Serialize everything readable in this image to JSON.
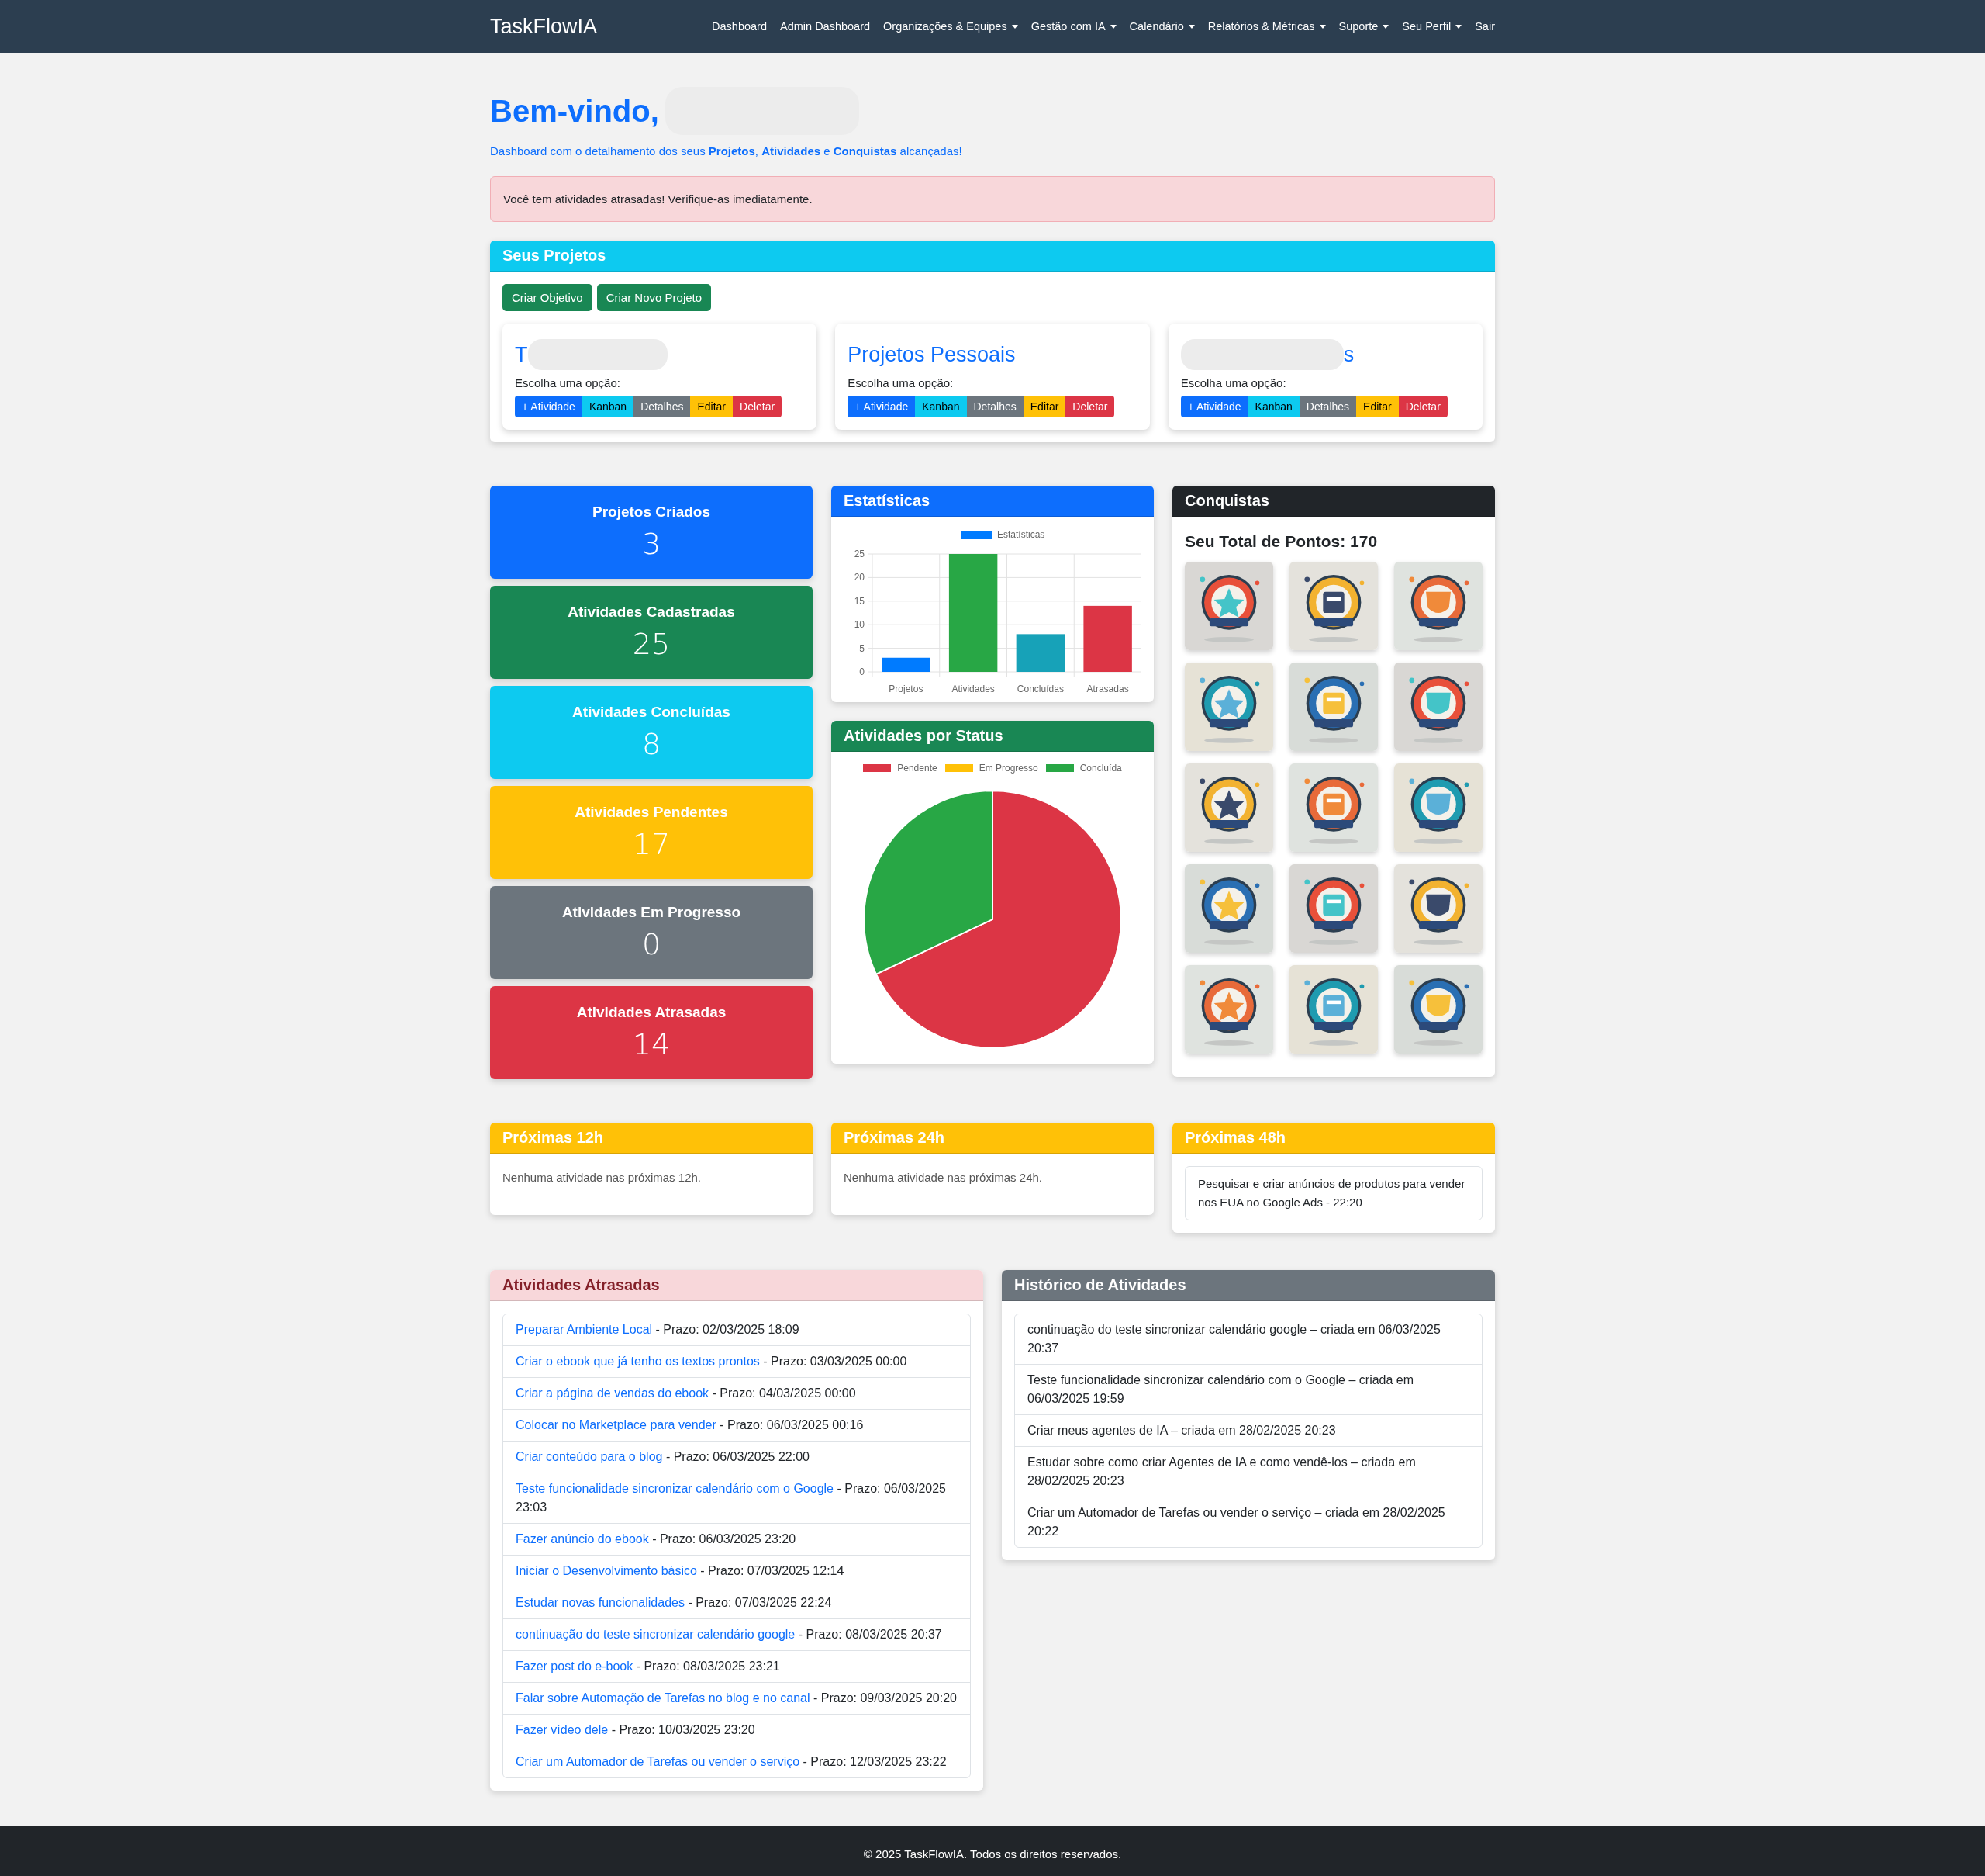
{
  "navbar": {
    "brand": "TaskFlowIA",
    "items": [
      {
        "label": "Dashboard",
        "dropdown": false
      },
      {
        "label": "Admin Dashboard",
        "dropdown": false
      },
      {
        "label": "Organizações & Equipes",
        "dropdown": true
      },
      {
        "label": "Gestão com IA",
        "dropdown": true
      },
      {
        "label": "Calendário",
        "dropdown": true
      },
      {
        "label": "Relatórios & Métricas",
        "dropdown": true
      },
      {
        "label": "Suporte",
        "dropdown": true
      },
      {
        "label": "Seu Perfil",
        "dropdown": true
      },
      {
        "label": "Sair",
        "dropdown": false
      }
    ]
  },
  "welcome": {
    "title": "Bem-vindo,",
    "redacted_after": true,
    "subtitle": "Dashboard com o detalhamento dos seus **Projetos**, **Atividades** e **Conquistas** alcançadas!"
  },
  "alert": "Você tem atividades atrasadas! Verifique-as imediatamente.",
  "projects": {
    "title": "Seus Projetos",
    "buttons": [
      "Criar Objetivo",
      "Criar Novo Projeto"
    ],
    "items": [
      {
        "title": "T",
        "redacted_before": false,
        "redacted_after": true,
        "prompt": "Escolha uma opção:",
        "actions": [
          {
            "label": "+ Atividade",
            "kind": "primary"
          },
          {
            "label": "Kanban",
            "kind": "info"
          },
          {
            "label": "Detalhes",
            "kind": "secondary"
          },
          {
            "label": "Editar",
            "kind": "warning"
          },
          {
            "label": "Deletar",
            "kind": "danger"
          }
        ]
      },
      {
        "title": "Projetos Pessoais",
        "redacted_before": false,
        "redacted_after": false,
        "prompt": "Escolha uma opção:",
        "actions": [
          {
            "label": "+ Atividade",
            "kind": "primary"
          },
          {
            "label": "Kanban",
            "kind": "info"
          },
          {
            "label": "Detalhes",
            "kind": "secondary"
          },
          {
            "label": "Editar",
            "kind": "warning"
          },
          {
            "label": "Deletar",
            "kind": "danger"
          }
        ]
      },
      {
        "title": "s",
        "redacted_before": true,
        "redacted_after": false,
        "prompt": "Escolha uma opção:",
        "actions": [
          {
            "label": "+ Atividade",
            "kind": "primary"
          },
          {
            "label": "Kanban",
            "kind": "info"
          },
          {
            "label": "Detalhes",
            "kind": "secondary"
          },
          {
            "label": "Editar",
            "kind": "warning"
          },
          {
            "label": "Deletar",
            "kind": "danger"
          }
        ]
      }
    ]
  },
  "stats": [
    {
      "label": "Projetos Criados",
      "value": "3",
      "color": "#0d6efd"
    },
    {
      "label": "Atividades Cadastradas",
      "value": "25",
      "color": "#198754"
    },
    {
      "label": "Atividades Concluídas",
      "value": "8",
      "color": "#0dcaf0"
    },
    {
      "label": "Atividades Pendentes",
      "value": "17",
      "color": "#ffc107"
    },
    {
      "label": "Atividades Em Progresso",
      "value": "0",
      "color": "#6c757d"
    },
    {
      "label": "Atividades Atrasadas",
      "value": "14",
      "color": "#dc3545"
    }
  ],
  "statistics": {
    "title": "Estatísticas",
    "chart_data": {
      "type": "bar",
      "categories": [
        "Projetos",
        "Atividades",
        "Concluídas",
        "Atrasadas"
      ],
      "series": [
        {
          "name": "Estatísticas",
          "color": "#007bff",
          "values": [
            3,
            25,
            8,
            14
          ],
          "colors": [
            "#007bff",
            "#28a745",
            "#17a2b8",
            "#dc3545"
          ]
        }
      ],
      "ylim": [
        0,
        25
      ],
      "yticks": [
        {
          "value": 0,
          "label": "0"
        },
        {
          "value": 5,
          "label": "5"
        },
        {
          "value": 10,
          "label": "10"
        },
        {
          "value": 15,
          "label": "15"
        },
        {
          "value": 20,
          "label": "20"
        },
        {
          "value": 25,
          "label": "25"
        }
      ],
      "grid": true,
      "legend": true
    }
  },
  "status": {
    "title": "Atividades por Status",
    "chart_data": {
      "type": "pie",
      "categories": [
        "Pendente",
        "Em Progresso",
        "Concluída"
      ],
      "values": [
        68,
        0,
        32
      ],
      "colors": [
        "#dc3545",
        "#ffc107",
        "#28a745"
      ],
      "legend": true
    }
  },
  "achievements": {
    "title": "Conquistas",
    "points": "Seu Total de Pontos: 170"
  },
  "upcoming": [
    {
      "title": "Próximas 12h",
      "message": "Nenhuma atividade nas próximas 12h."
    },
    {
      "title": "Próximas 24h",
      "message": "Nenhuma atividade nas próximas 24h."
    },
    {
      "title": "Próximas 48h",
      "items": [
        "Pesquisar e criar anúncios de produtos para vender nos EUA no Google Ads - 22:20"
      ]
    }
  ],
  "overdue": {
    "title": "Atividades Atrasadas",
    "items": [
      {
        "link": "Preparar Ambiente Local",
        "detail": "- Prazo: 02/03/2025 18:09"
      },
      {
        "link": "Criar o ebook que já tenho os textos prontos",
        "detail": "- Prazo: 03/03/2025 00:00"
      },
      {
        "link": "Criar a página de vendas do ebook",
        "detail": "- Prazo: 04/03/2025 00:00"
      },
      {
        "link": "Colocar no Marketplace para vender",
        "detail": "- Prazo: 06/03/2025 00:16"
      },
      {
        "link": "Criar conteúdo para o blog",
        "detail": "- Prazo: 06/03/2025 22:00"
      },
      {
        "link": "Teste funcionalidade sincronizar calendário com o Google",
        "detail": "- Prazo: 06/03/2025 23:03"
      },
      {
        "link": "Fazer anúncio do ebook",
        "detail": "- Prazo: 06/03/2025 23:20"
      },
      {
        "link": "Iniciar o Desenvolvimento básico",
        "detail": "- Prazo: 07/03/2025 12:14"
      },
      {
        "link": "Estudar novas funcionalidades",
        "detail": "- Prazo: 07/03/2025 22:24"
      },
      {
        "link": "continuação do teste sincronizar calendário google",
        "detail": "- Prazo: 08/03/2025 20:37"
      },
      {
        "link": "Fazer post do e-book",
        "detail": "- Prazo: 08/03/2025 23:21"
      },
      {
        "link": "Falar sobre Automação de Tarefas no blog e no canal",
        "detail": "- Prazo: 09/03/2025 20:20"
      },
      {
        "link": "Fazer vídeo dele",
        "detail": "- Prazo: 10/03/2025 23:20"
      },
      {
        "link": "Criar um Automador de Tarefas ou vender o serviço",
        "detail": "- Prazo: 12/03/2025 23:22"
      }
    ]
  },
  "history": {
    "title": "Histórico de Atividades",
    "items": [
      "continuação do teste sincronizar calendário google – criada em 06/03/2025 20:37",
      "Teste funcionalidade sincronizar calendário com o Google – criada em 06/03/2025 19:59",
      "Criar meus agentes de IA – criada em 28/02/2025 20:23",
      "Estudar sobre como criar Agentes de IA e como vendê-los – criada em 28/02/2025 20:23",
      "Criar um Automador de Tarefas ou vender o serviço – criada em 28/02/2025 20:22"
    ]
  },
  "footer": "© 2025 TaskFlowIA. Todos os direitos reservados."
}
